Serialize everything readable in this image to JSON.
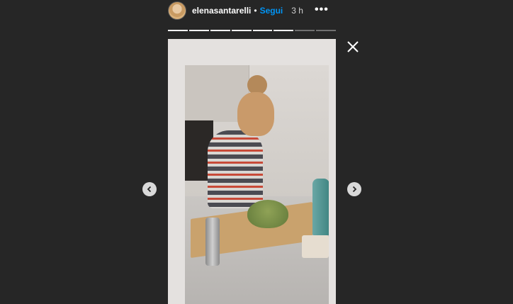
{
  "header": {
    "username": "elenasantarelli",
    "separator": "•",
    "follow_label": "Segui",
    "time_ago": "3 h",
    "more_label": "•••"
  },
  "progress": {
    "segments_total": 8,
    "current_segment": 6
  },
  "icons": {
    "close": "close-icon",
    "prev": "chevron-left-icon",
    "next": "chevron-right-icon",
    "more": "more-horizontal-icon"
  },
  "colors": {
    "background": "#262626",
    "follow": "#0095f6",
    "text": "#ffffff"
  }
}
